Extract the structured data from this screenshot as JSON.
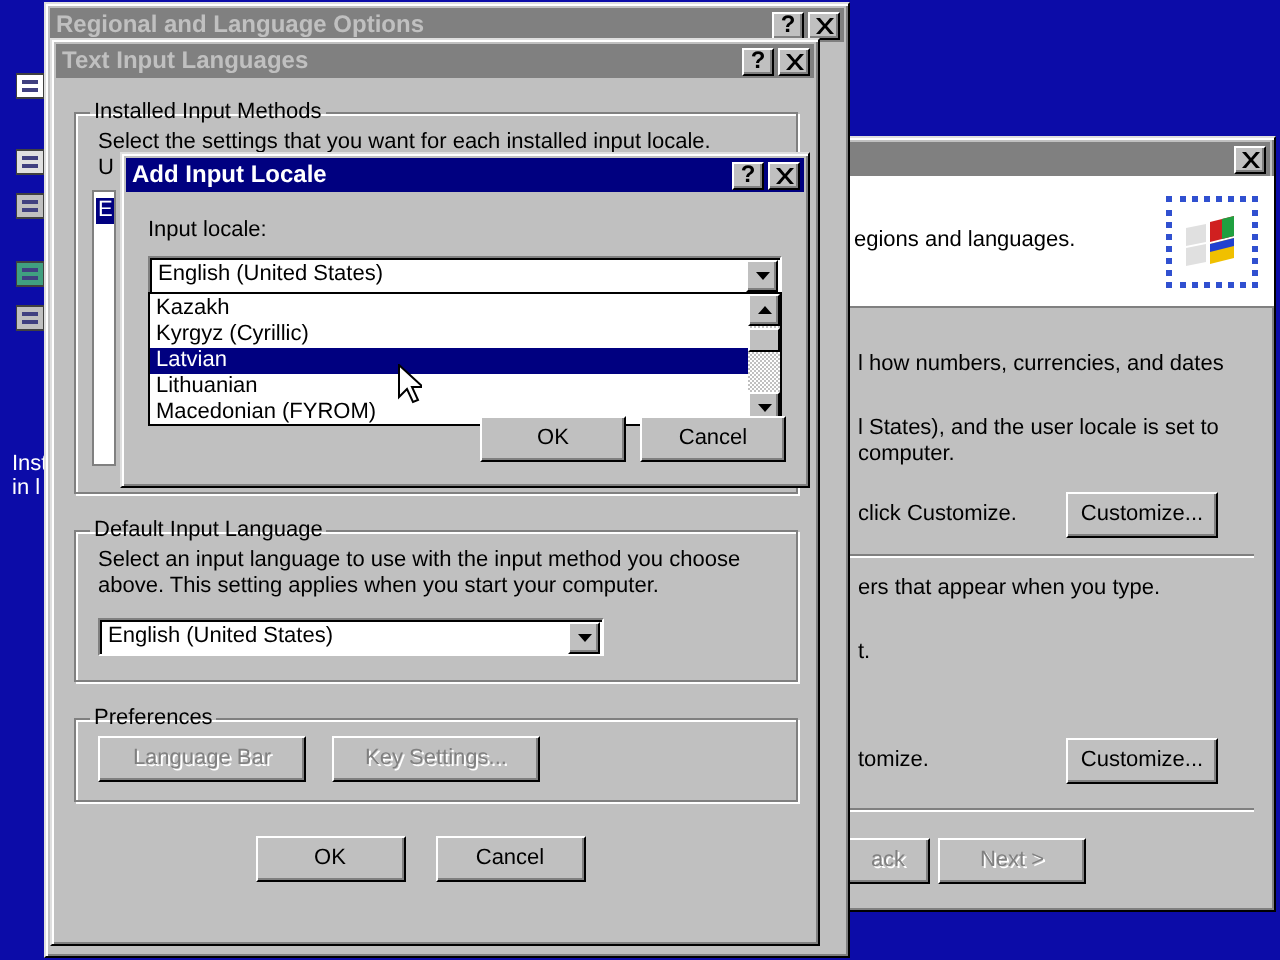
{
  "desktop": {
    "texts": [
      "Inst",
      "in l"
    ]
  },
  "wizard_window": {
    "active": false,
    "header_text": "egions and languages.",
    "lines": [
      {
        "kind": "text",
        "text": "l how numbers, currencies, and dates"
      },
      {
        "kind": "gap_text",
        "text": "l States), and the user locale is set to"
      },
      {
        "kind": "text",
        "text": "computer."
      },
      {
        "kind": "button_row",
        "text": "click Customize.",
        "button": "Customize..."
      },
      {
        "kind": "rule"
      },
      {
        "kind": "text",
        "text": "ers that appear when you type."
      },
      {
        "kind": "gap_text",
        "text": "t."
      },
      {
        "kind": "button_row",
        "text": "tomize.",
        "button": "Customize..."
      },
      {
        "kind": "rule"
      }
    ],
    "nav_buttons": [
      {
        "label": "ack",
        "disabled": true
      },
      {
        "label": "Next >",
        "disabled": true
      }
    ]
  },
  "regional_window": {
    "title": "Regional and Language Options",
    "active": false,
    "help_button": "?"
  },
  "text_input_window": {
    "title": "Text Input Languages",
    "active": false,
    "help_button": "?",
    "installed_group": {
      "title": "Installed Input Methods",
      "lines": [
        "Select the settings that you want for each installed input locale.",
        "U"
      ],
      "list_items": [
        {
          "label": "E",
          "selected": true
        }
      ]
    },
    "default_group": {
      "title": "Default Input Language",
      "text": "Select an input language to use with the input method you choose above. This setting applies when you start your computer.",
      "value": "English (United States)"
    },
    "preferences_group": {
      "title": "Preferences",
      "buttons": [
        {
          "label": "Language Bar",
          "disabled": true
        },
        {
          "label": "Key Settings...",
          "disabled": true
        }
      ]
    },
    "buttons": [
      {
        "label": "OK",
        "disabled": false
      },
      {
        "label": "Cancel",
        "disabled": false
      }
    ]
  },
  "add_locale_dialog": {
    "title": "Add Input Locale",
    "active": true,
    "help_button": "?",
    "label": "Input locale:",
    "value": "English (United States)",
    "dropdown_items": [
      {
        "label": "Kazakh",
        "selected": false
      },
      {
        "label": "Kyrgyz (Cyrillic)",
        "selected": false
      },
      {
        "label": "Latvian",
        "selected": true
      },
      {
        "label": "Lithuanian",
        "selected": false
      },
      {
        "label": "Macedonian (FYROM)",
        "selected": false
      }
    ],
    "buttons": [
      {
        "label": "OK",
        "disabled": false
      },
      {
        "label": "Cancel",
        "disabled": false
      }
    ]
  }
}
